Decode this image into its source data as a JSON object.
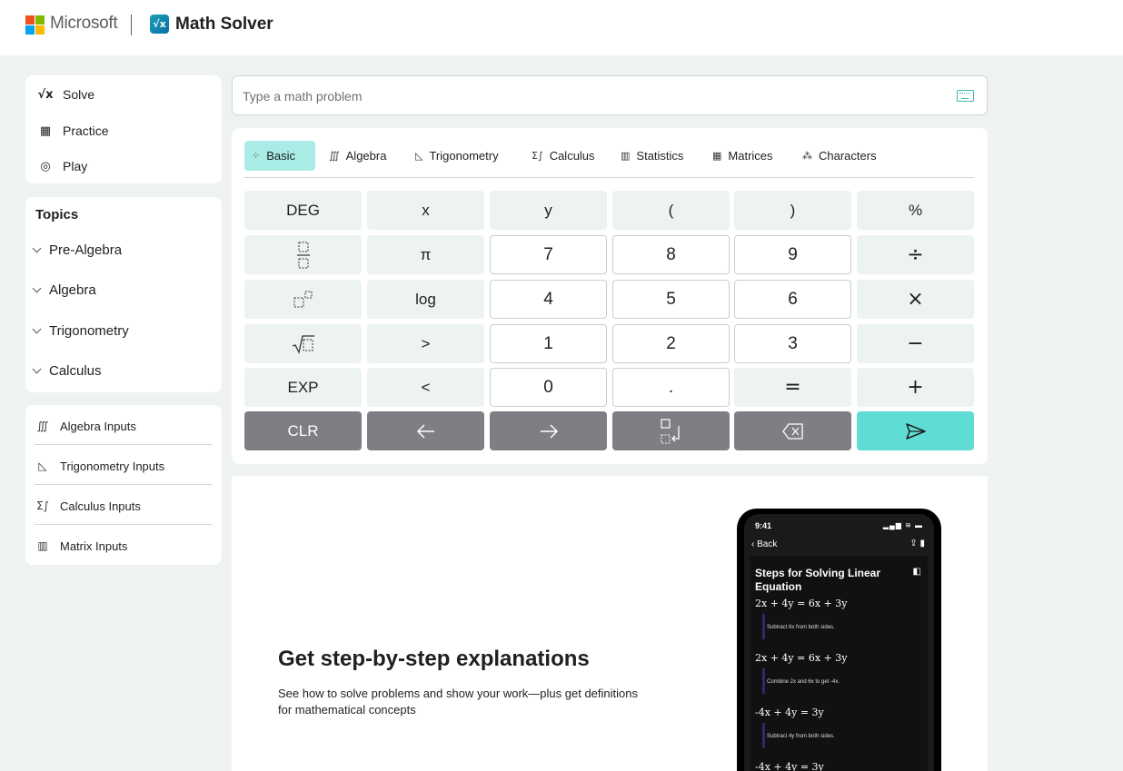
{
  "header": {
    "brand": "Microsoft",
    "app_name": "Math Solver",
    "logo_colors": [
      "#f25022",
      "#7fba00",
      "#00a4ef",
      "#ffb900"
    ]
  },
  "nav": {
    "items": [
      {
        "label": "Solve",
        "icon": "square-root-icon"
      },
      {
        "label": "Practice",
        "icon": "practice-icon"
      },
      {
        "label": "Play",
        "icon": "gamepad-icon"
      }
    ]
  },
  "topics": {
    "title": "Topics",
    "items": [
      "Pre-Algebra",
      "Algebra",
      "Trigonometry",
      "Calculus"
    ]
  },
  "input_links": {
    "items": [
      {
        "label": "Algebra Inputs",
        "icon": "algebra-icon"
      },
      {
        "label": "Trigonometry Inputs",
        "icon": "triangle-icon"
      },
      {
        "label": "Calculus Inputs",
        "icon": "calculus-icon"
      },
      {
        "label": "Matrix Inputs",
        "icon": "matrix-icon"
      }
    ]
  },
  "search": {
    "placeholder": "Type a math problem",
    "value": ""
  },
  "calculator": {
    "tabs": [
      {
        "label": "Basic",
        "icon": "basic-icon",
        "active": true
      },
      {
        "label": "Algebra",
        "icon": "algebra-icon"
      },
      {
        "label": "Trigonometry",
        "icon": "triangle-icon"
      },
      {
        "label": "Calculus",
        "icon": "calculus-icon"
      },
      {
        "label": "Statistics",
        "icon": "statistics-icon"
      },
      {
        "label": "Matrices",
        "icon": "matrix-icon"
      },
      {
        "label": "Characters",
        "icon": "characters-icon"
      }
    ],
    "keys": {
      "deg": "DEG",
      "x": "x",
      "y": "y",
      "lparen": "(",
      "rparen": ")",
      "percent": "%",
      "pi": "π",
      "n7": "7",
      "n8": "8",
      "n9": "9",
      "divide": "÷",
      "log": "log",
      "n4": "4",
      "n5": "5",
      "n6": "6",
      "multiply": "×",
      "gt": ">",
      "n1": "1",
      "n2": "2",
      "n3": "3",
      "minus": "−",
      "exp": "EXP",
      "lt": "<",
      "n0": "0",
      "dot": ".",
      "equals": "=",
      "plus": "+",
      "clr": "CLR"
    }
  },
  "promo": {
    "title": "Get step-by-step explanations",
    "text": "See how to solve problems and show your work—plus get definitions for mathematical concepts"
  },
  "phone": {
    "time": "9:41",
    "back": "Back",
    "title": "Steps for Solving Linear Equation",
    "eq1": "2x + 4y = 6x + 3y",
    "note1": "Subtract 6x from both sides.",
    "eq2": "2x + 4y = 6x + 3y",
    "note2": "Combine 2x and 6x to get -4x.",
    "eq3": "-4x + 4y = 3y",
    "note3": "Subtract 4y from both sides.",
    "eq4": "-4x + 4y = 3y"
  }
}
